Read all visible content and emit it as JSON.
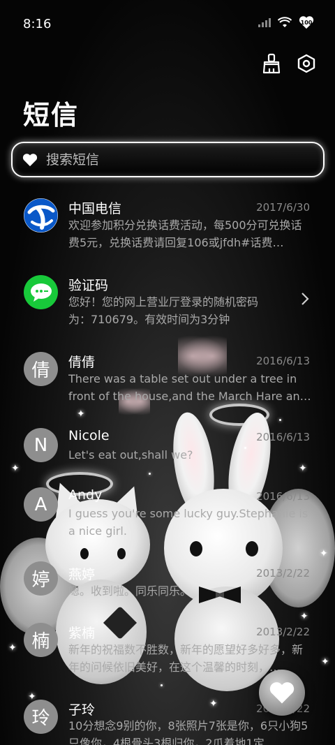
{
  "status_bar": {
    "time": "8:16",
    "battery": "100"
  },
  "header": {
    "title": "短信",
    "icons": [
      "broom-icon",
      "settings-hexagon-icon"
    ]
  },
  "search": {
    "placeholder": "搜索短信",
    "icon": "heart-icon"
  },
  "messages": [
    {
      "avatar_type": "telecom-logo",
      "name": "中国电信",
      "date": "2017/6/30",
      "preview": "欢迎参加积分兑换话费活动，每500分可兑换话费5元，兑换话费请回复106或jfdh#话费…"
    },
    {
      "avatar_type": "chat-bubble-logo",
      "name": "验证码",
      "date": "",
      "preview": "您好！您的网上营业厅登录的随机密码为：710679。有效时间为3分钟",
      "has_chevron": true
    },
    {
      "avatar_letter": "倩",
      "name": "倩倩",
      "date": "2016/6/13",
      "preview": "There was a table set out under a tree in front of the house,and the March Hare an…"
    },
    {
      "avatar_letter": "N",
      "name": "Nicole",
      "date": "2016/6/13",
      "preview": "Let's eat out,shall we?"
    },
    {
      "avatar_letter": "A",
      "name": "Andy",
      "date": "2016/6/13",
      "preview": "I guess you're some lucky guy.Stephanie is a nice girl."
    },
    {
      "avatar_letter": "婷",
      "name": "燕婷",
      "date": "2013/2/22",
      "preview": "嗯。收到啦。同乐同乐。"
    },
    {
      "avatar_letter": "楠",
      "name": "紫楠",
      "date": "2013/2/22",
      "preview": "新年的祝福数不胜数，新年的愿望好多好多，新年的问候依旧美好，在这个温馨的时刻，…"
    },
    {
      "avatar_letter": "玲",
      "name": "子玲",
      "date": "2013/2/22",
      "preview": "10分想念9别的你，8张照片7张是你，6只小狗5只像你，4根骨头3根归你，2爪着地1定…"
    }
  ],
  "colors": {
    "background": "#000000",
    "avatar_gray": "#8e8e8e",
    "verify_green": "#18c93a",
    "telecom_blue": "#0a58c8",
    "date_gray": "#8a8a8a"
  },
  "fab": {
    "icon": "heart-icon"
  }
}
